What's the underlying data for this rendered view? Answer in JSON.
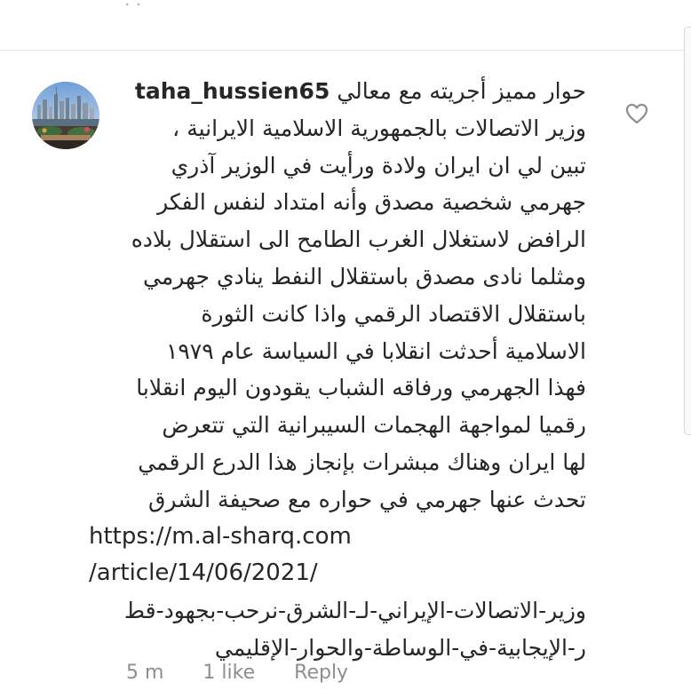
{
  "previous_comment": {
    "stub_text": "ᐧ ᐧ"
  },
  "comment": {
    "username": "taha_hussien65",
    "lines": [
      "حوار مميز أجريته مع معالي",
      "وزير الاتصالات بالجمهورية الاسلامية الايرانية ،",
      "تبين لي ان ايران ولادة ورأيت في الوزير آذري",
      "جهرمي شخصية مصدق وأنه امتداد لنفس الفكر",
      "الرافض لاستغلال الغرب الطامح الى استقلال بلاده",
      "ومثلما نادى مصدق باستقلال النفط ينادي جهرمي",
      "باستقلال الاقتصاد الرقمي واذا كانت الثورة",
      "الاسلامية أحدثت انقلابا في السياسة عام ١٩٧٩",
      "فهذا الجهرمي ورفاقه الشباب يقودون اليوم انقلابا",
      "رقميا لمواجهة الهجمات السيبرانية التي تتعرض",
      "لها ايران وهناك مبشرات بإنجاز هذا الدرع الرقمي",
      "تحدث عنها جهرمي في حواره مع صحيفة الشرق"
    ],
    "link_lines": [
      "https://m.al-sharq.com",
      "/article/14/06/2021/"
    ],
    "slug_lines": [
      "وزير-الاتصالات-الإيراني-لـ-الشرق-نرحب-بجهود-قط",
      "ر-الإيجابية-في-الوساطة-والحوار-الإقليمي"
    ]
  },
  "meta": {
    "time": "5 m",
    "likes": "1 like",
    "reply": "Reply"
  },
  "icons": {
    "like": "heart-outline-icon",
    "avatar": "city-skyline-photo"
  },
  "colors": {
    "text": "#262626",
    "meta": "#8e8e8e",
    "divider": "#e6e6e6"
  }
}
